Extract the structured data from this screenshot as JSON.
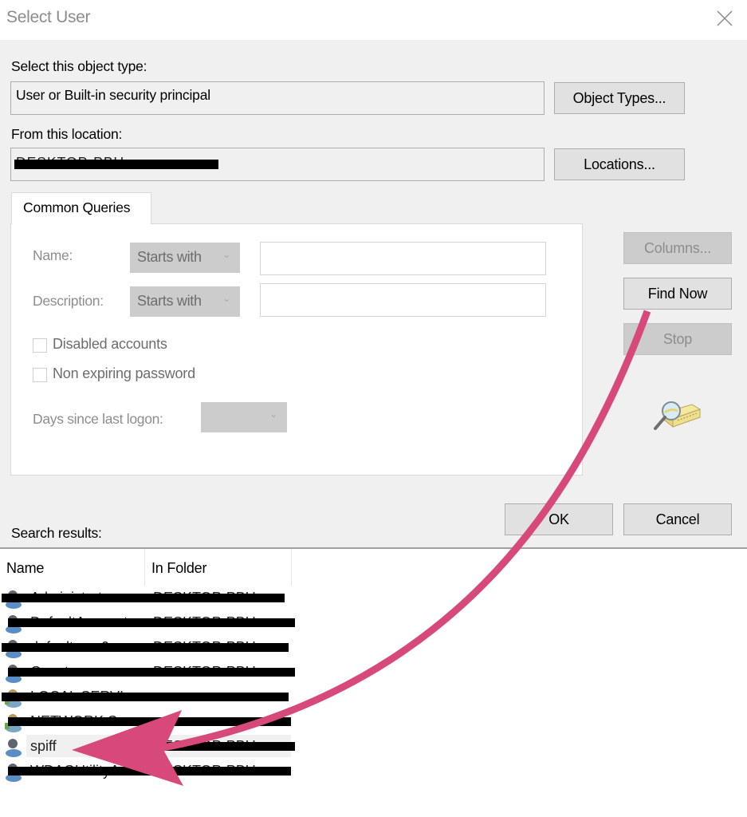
{
  "window": {
    "title": "Select User",
    "close_icon": "close-icon"
  },
  "object_type": {
    "label": "Select this object type:",
    "value": "User or Built-in security principal",
    "button": "Object Types..."
  },
  "location": {
    "label": "From this location:",
    "value": "DESKTOP-PBU...",
    "value_redacted": true,
    "button": "Locations..."
  },
  "tabs": [
    {
      "label": "Common Queries",
      "active": true
    }
  ],
  "common_queries": {
    "name_label": "Name:",
    "name_match": "Starts with",
    "name_value": "",
    "description_label": "Description:",
    "description_match": "Starts with",
    "description_value": "",
    "disabled_accounts_label": "Disabled accounts",
    "disabled_accounts_checked": false,
    "non_expiring_label": "Non expiring password",
    "non_expiring_checked": false,
    "days_label": "Days since last logon:",
    "days_value": ""
  },
  "side_buttons": {
    "columns": "Columns...",
    "find_now": "Find Now",
    "stop": "Stop",
    "search_icon": "find-magnifier-icon"
  },
  "footer": {
    "ok": "OK",
    "cancel": "Cancel",
    "results_label": "Search results:"
  },
  "results": {
    "columns": [
      "Name",
      "In Folder"
    ],
    "rows": [
      {
        "name": "Administrator",
        "folder": "DESKTOP-PBU...",
        "redacted": true,
        "icon": "user-icon"
      },
      {
        "name": "DefaultAccount",
        "folder": "DESKTOP-PBU...",
        "redacted": true,
        "icon": "user-icon"
      },
      {
        "name": "defaultuser0",
        "folder": "DESKTOP-PBU...",
        "redacted": true,
        "icon": "user-icon"
      },
      {
        "name": "Guest",
        "folder": "DESKTOP-PBU...",
        "redacted": true,
        "icon": "user-icon"
      },
      {
        "name": "LOCAL SERVI...",
        "folder": "",
        "redacted": true,
        "icon": "service-principal-icon"
      },
      {
        "name": "NETWORK S...",
        "folder": "",
        "redacted": true,
        "icon": "service-principal-icon"
      },
      {
        "name": "spiff",
        "folder": "DESKTOP-PBU...",
        "redacted": false,
        "folder_redacted": true,
        "selected": true,
        "icon": "user-icon"
      },
      {
        "name": "WDAGUtilityA...",
        "folder": "DESKTOP-PBU...",
        "redacted": true,
        "icon": "user-icon"
      }
    ]
  },
  "annotation": {
    "type": "curved-arrow",
    "from": "Find Now",
    "to": "spiff",
    "color": "#d6497a"
  }
}
